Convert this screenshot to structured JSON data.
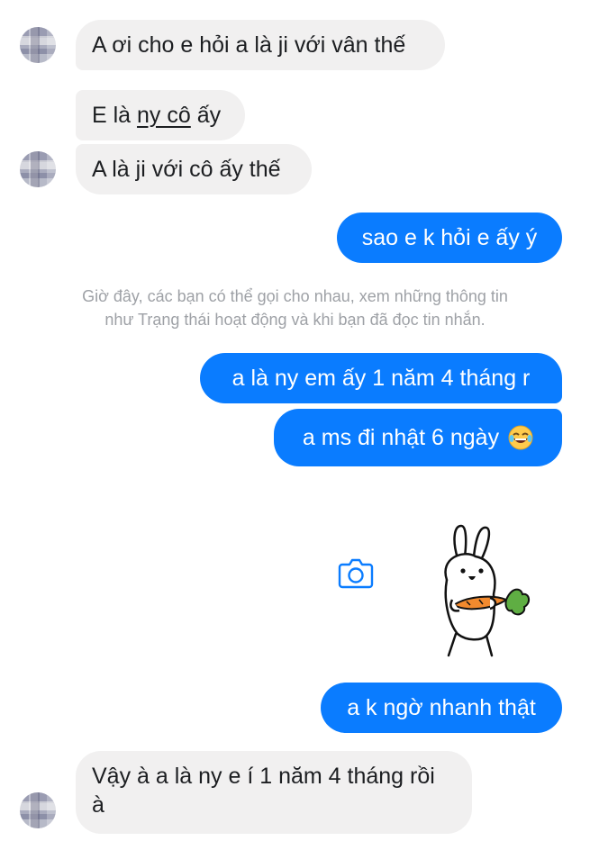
{
  "messages": {
    "m1": "A ơi cho e hỏi a là ji với vân thế",
    "m2_prefix": "E là ",
    "m2_underlined": "ny cô",
    "m2_suffix": " ấy",
    "m3": "A là ji với cô ấy thế",
    "m4": "sao e k hỏi e ấy ý",
    "m5": "a là ny em ấy 1 năm 4 tháng r",
    "m6": "a ms đi nhật 6 ngày",
    "m7": "a k ngờ nhanh thật",
    "m8_line1": "Vậy à a là ny e í 1 năm 4 tháng rồi",
    "m8_line2": "à"
  },
  "system_notice": {
    "line1": "Giờ đây, các bạn có thể gọi cho nhau, xem những thông tin",
    "line2": "như Trạng thái hoạt động và khi bạn đã đọc tin nhắn."
  },
  "icons": {
    "camera": "camera-icon",
    "emoji": "laughing-emoji-icon",
    "sticker": "rabbit-carrot-sticker"
  },
  "colors": {
    "outgoing_bubble": "#0a7cff",
    "incoming_bubble": "#f1f0f0",
    "system_text": "#9ea1a6"
  }
}
